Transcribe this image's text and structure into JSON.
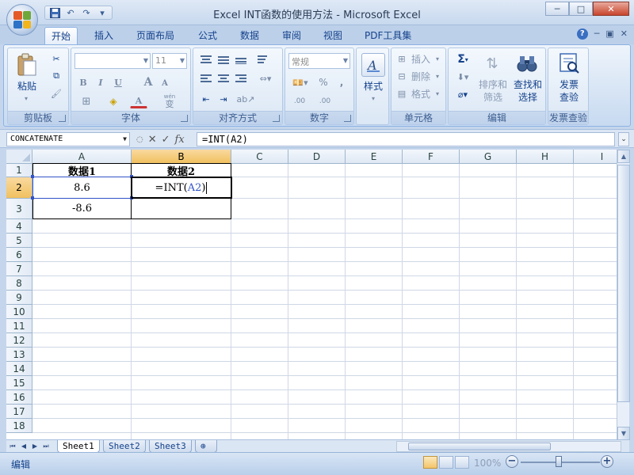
{
  "window": {
    "title": "Excel INT函数的使用方法 - Microsoft Excel",
    "controls": [
      "─",
      "□",
      "✕"
    ]
  },
  "qat": {
    "icons": [
      "save-icon",
      "undo-icon",
      "redo-icon",
      "customize-icon"
    ]
  },
  "ribbon": {
    "tabs": [
      "开始",
      "插入",
      "页面布局",
      "公式",
      "数据",
      "审阅",
      "视图",
      "PDF工具集"
    ],
    "active_tab": "开始",
    "groups": {
      "clipboard": {
        "label": "剪贴板",
        "paste": "粘贴"
      },
      "font": {
        "label": "字体",
        "font_name": "",
        "font_size": "11",
        "bold": "B",
        "italic": "I",
        "underline": "U",
        "grow": "A",
        "shrink": "A",
        "color_a": "A",
        "wen": "wén",
        "wen_char": "变"
      },
      "alignment": {
        "label": "对齐方式"
      },
      "number": {
        "label": "数字",
        "format": "常规",
        "percent": "%",
        "comma": ",",
        "inc_decimal": ".00",
        "dec_decimal": ".00"
      },
      "styles": {
        "label": "样式"
      },
      "cells": {
        "label": "单元格",
        "insert": "插入",
        "delete": "删除",
        "format": "格式"
      },
      "editing": {
        "label": "编辑",
        "sigma": "Σ",
        "sort_filter_1": "排序和",
        "sort_filter_2": "筛选",
        "find_select_1": "查找和",
        "find_select_2": "选择"
      },
      "invoice": {
        "label": "发票查验",
        "btn_1": "发票",
        "btn_2": "查验"
      }
    }
  },
  "formula_bar": {
    "name_box": "CONCATENATE",
    "fx": "fx",
    "formula": "=INT(A2)"
  },
  "grid": {
    "columns": [
      "A",
      "B",
      "C",
      "D",
      "E",
      "F",
      "G",
      "H",
      "I"
    ],
    "rows": [
      "1",
      "2",
      "3",
      "4",
      "5",
      "6",
      "7",
      "8",
      "9",
      "10",
      "11",
      "12",
      "13",
      "14",
      "15",
      "16",
      "17",
      "18"
    ],
    "cells": {
      "A1": "数据1",
      "B1": "数据2",
      "A2": "8.6",
      "B2_prefix": "=INT(",
      "B2_ref": "A2",
      "B2_suffix": ")",
      "A3": "-8.6"
    }
  },
  "sheets": [
    "Sheet1",
    "Sheet2",
    "Sheet3"
  ],
  "status": {
    "mode": "编辑",
    "zoom": "100%",
    "zoom_minus": "−",
    "zoom_plus": "+"
  },
  "colors": {
    "ribbon_text": "#15428b",
    "selection_header": "#f1c15f",
    "reference_blue": "#3153c8"
  }
}
